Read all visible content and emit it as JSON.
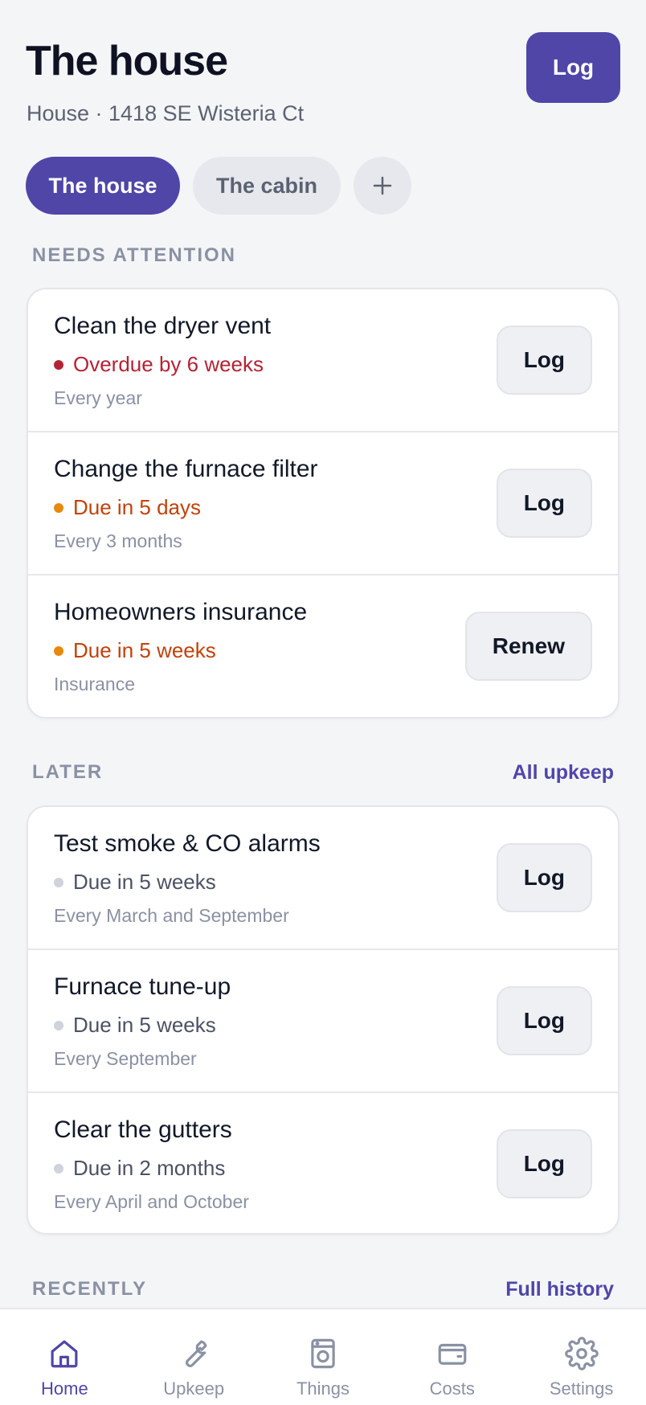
{
  "header": {
    "title": "The house",
    "subtitle": "House · 1418 SE Wisteria Ct",
    "log_label": "Log"
  },
  "properties": {
    "items": [
      {
        "label": "The house",
        "active": true
      },
      {
        "label": "The cabin",
        "active": false
      }
    ],
    "add_icon": "plus-icon"
  },
  "needs_attention": {
    "heading": "NEEDS ATTENTION",
    "items": [
      {
        "title": "Clean the dryer vent",
        "status": "Overdue by 6 weeks",
        "status_color": "#b42335",
        "frequency": "Every year",
        "action": "Log"
      },
      {
        "title": "Change the furnace filter",
        "status": "Due in 5 days",
        "status_color": "#e8890c",
        "frequency": "Every 3 months",
        "action": "Log"
      },
      {
        "title": "Homeowners insurance",
        "status": "Due in 5 weeks",
        "status_color": "#e8890c",
        "frequency": "Insurance",
        "action": "Renew"
      }
    ]
  },
  "later": {
    "heading": "LATER",
    "link": "All upkeep",
    "items": [
      {
        "title": "Test smoke & CO alarms",
        "status": "Due in 5 weeks",
        "status_color": "#cfd3dc",
        "frequency": "Every March and September",
        "action": "Log"
      },
      {
        "title": "Furnace tune-up",
        "status": "Due in 5 weeks",
        "status_color": "#cfd3dc",
        "frequency": "Every September",
        "action": "Log"
      },
      {
        "title": "Clear the gutters",
        "status": "Due in 2 months",
        "status_color": "#cfd3dc",
        "frequency": "Every April and October",
        "action": "Log"
      }
    ]
  },
  "recently": {
    "heading": "RECENTLY",
    "link": "Full history"
  },
  "nav": {
    "items": [
      {
        "label": "Home",
        "icon": "home-icon",
        "active": true
      },
      {
        "label": "Upkeep",
        "icon": "wrench-icon",
        "active": false
      },
      {
        "label": "Things",
        "icon": "washer-icon",
        "active": false
      },
      {
        "label": "Costs",
        "icon": "wallet-icon",
        "active": false
      },
      {
        "label": "Settings",
        "icon": "gear-icon",
        "active": false
      }
    ]
  },
  "colors": {
    "accent": "#4f46a8",
    "overdue": "#b42335",
    "due_soon": "#e8890c",
    "later": "#cfd3dc"
  }
}
